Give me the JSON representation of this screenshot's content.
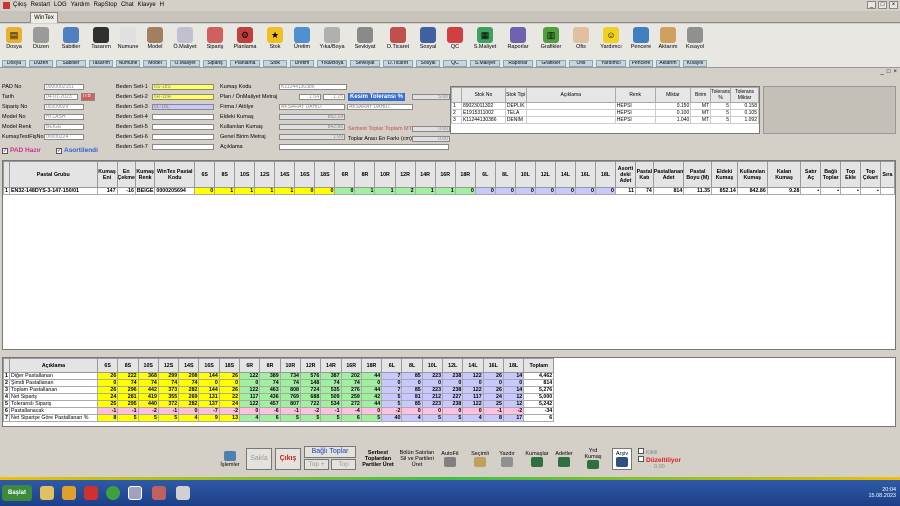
{
  "menu": [
    "Çıkış",
    "Restart",
    "LOG",
    "Yardım",
    "RapStop",
    "Chat",
    "Klavye",
    "H"
  ],
  "tab_title": "WinTex",
  "ribbon": [
    {
      "label": "Dosya",
      "sub": "Dosya",
      "icon": "folder-icon",
      "color": "#e8b030"
    },
    {
      "label": "Düzen",
      "sub": "Düzen",
      "icon": "edit-icon",
      "color": "#9a9a9a"
    },
    {
      "label": "Sabitler",
      "sub": "Sabitler",
      "icon": "pin-icon",
      "color": "#5080c0"
    },
    {
      "label": "Tasarım",
      "sub": "Tasarım",
      "icon": "design-icon",
      "color": "#303030"
    },
    {
      "label": "Numune",
      "sub": "Numune",
      "icon": "sample-icon",
      "color": "#e0e0e0"
    },
    {
      "label": "Model",
      "sub": "Model",
      "icon": "model-icon",
      "color": "#a08060"
    },
    {
      "label": "Ö.Maliyet",
      "sub": "Ö.Maliyet",
      "icon": "cost-icon",
      "color": "#c0c0d0"
    },
    {
      "label": "Sipariş",
      "sub": "Sipariş",
      "icon": "order-icon",
      "color": "#d06060"
    },
    {
      "label": "Planlama",
      "sub": "Planlama",
      "icon": "gear-icon",
      "color": "#c04040"
    },
    {
      "label": "Stok",
      "sub": "Stok",
      "icon": "star-icon",
      "color": "#f0c020"
    },
    {
      "label": "Üretim",
      "sub": "Üretim",
      "icon": "production-icon",
      "color": "#5090d0"
    },
    {
      "label": "Yıka/Boya",
      "sub": "Yıka/Boya",
      "icon": "dye-icon",
      "color": "#b0b0b0"
    },
    {
      "label": "Sevkiyat",
      "sub": "Sevkiyat",
      "icon": "shipping-icon",
      "color": "#8a8a8a"
    },
    {
      "label": "D.Ticaret",
      "sub": "D.Ticaret",
      "icon": "trade-icon",
      "color": "#c05050"
    },
    {
      "label": "Sosyal",
      "sub": "Sosyal",
      "icon": "social-icon",
      "color": "#4060a0"
    },
    {
      "label": "QC",
      "sub": "QC",
      "icon": "qc-icon",
      "color": "#d04040"
    },
    {
      "label": "S.Maliyet",
      "sub": "S.Maliyet",
      "icon": "calculator-icon",
      "color": "#40a060"
    },
    {
      "label": "Raporlar",
      "sub": "Raporlar",
      "icon": "report-icon",
      "color": "#7060b0"
    },
    {
      "label": "Grafikler",
      "sub": "Grafikler",
      "icon": "chart-icon",
      "color": "#50a040"
    },
    {
      "label": "Ofis",
      "sub": "Ofis",
      "icon": "office-icon",
      "color": "#e0c0a0"
    },
    {
      "label": "Yardımcı",
      "sub": "Yardımcı",
      "icon": "smiley-icon",
      "color": "#f0d020"
    },
    {
      "label": "Pencere",
      "sub": "Pencere",
      "icon": "window-icon",
      "color": "#4080c0"
    },
    {
      "label": "Aktarım",
      "sub": "Aktarım",
      "icon": "transfer-icon",
      "color": "#d0a060"
    },
    {
      "label": "Kısayol",
      "sub": "Kısayol",
      "icon": "shortcut-icon",
      "color": "#909090"
    }
  ],
  "form": {
    "pad_no": {
      "label": "PAD No",
      "value": "0000002151"
    },
    "tarih": {
      "label": "Tarih",
      "value": "04-01-2023",
      "btn": "ITB"
    },
    "siparis_no": {
      "label": "Sipariş No",
      "value": "00209029"
    },
    "model_no": {
      "label": "Model No",
      "value": "HI LASH"
    },
    "model_renk": {
      "label": "Model Renk",
      "value": "BEIGE"
    },
    "kumas_test": {
      "label": "KumaşTestFişNo",
      "value": "00000224"
    },
    "beden_setleri": [
      {
        "label": "Beden Seti-1",
        "value": "6S-18S",
        "color": "y"
      },
      {
        "label": "Beden Seti-2",
        "value": "6R-18R",
        "color": "y"
      },
      {
        "label": "Beden Seti-3",
        "value": "6L-18L",
        "color": "p"
      },
      {
        "label": "Beden Seti-4",
        "value": "",
        "color": ""
      },
      {
        "label": "Beden Seti-5",
        "value": "",
        "color": ""
      },
      {
        "label": "Beden Seti-6",
        "value": "",
        "color": ""
      },
      {
        "label": "Beden Seti-7",
        "value": "",
        "color": ""
      }
    ],
    "kumas_kodu": {
      "label": "Kumaş Kodu",
      "value": "K11244130386"
    },
    "plan_metraj": {
      "label": "Plan / ÖnMaliyet Metraj",
      "value1": "1.04",
      "value2": "1.15"
    },
    "firma": {
      "label": "Firma / Atölye",
      "value": "AKSARAY DAHİLİ",
      "value2": "AKSARAY DAHİLİ"
    },
    "eldeki_kumas": {
      "label": "Eldeki Kumaş",
      "value": "852.14"
    },
    "kullanilan_kumas": {
      "label": "Kullanılan Kumaş",
      "value": "842.86"
    },
    "genel_birim": {
      "label": "Genel Birim Metraj",
      "value": "1.09"
    },
    "aciklama": {
      "label": "Açıklama",
      "value": ""
    },
    "kesim_tol": {
      "label": "Kesim Toleransı %",
      "value": "5.00"
    },
    "serbest_toplam": {
      "label": "Serbest Toplar Toplam MT",
      "value": "0.00"
    },
    "toplar_arasi": {
      "label": "Toplar Arası En Farkı (cm)",
      "value": "0.00"
    }
  },
  "stock_table": {
    "headers": [
      "Stok No",
      "Stok Tipi",
      "Açıklama",
      "Renk",
      "Miktar",
      "Birim",
      "Tolerans %",
      "Tolerans Miktar"
    ],
    "rows": [
      [
        "1",
        "89023011302",
        "DEPLIK",
        "",
        "HEPSI",
        "0.150",
        "MT",
        "5",
        "0.158"
      ],
      [
        "2",
        "E1915311002",
        "TELA",
        "",
        "HEPSI",
        "0.100",
        "MT",
        "5",
        "0.105"
      ],
      [
        "3",
        "K11244130386",
        "DENIM",
        "",
        "HEPSI",
        "1.040",
        "MT",
        "5",
        "1.092"
      ]
    ]
  },
  "checks": {
    "pad_hazir": "PAD Hazır",
    "asortilendi": "Asortilendi"
  },
  "main_grid": {
    "headers": [
      "Pastal Grubu",
      "Kumaş Eni",
      "En Çekme",
      "Kumaş Renk",
      "WinTex Pastal Kodu",
      "6S",
      "8S",
      "10S",
      "12S",
      "14S",
      "16S",
      "18S",
      "6R",
      "8R",
      "10R",
      "12R",
      "14R",
      "16R",
      "18R",
      "6L",
      "8L",
      "10L",
      "12L",
      "14L",
      "16L",
      "18L",
      "Asorti deki Adet",
      "Pastal Katı",
      "Pastallanan Adet",
      "Pastal Boyu (M)",
      "Eldeki Kumaş",
      "Kullanılan Kumaş",
      "Kalan Kumaş",
      "Satır Aç",
      "Bağlı Toplar",
      "Top Ekle",
      "Top Çıkart",
      "Sıra"
    ],
    "rows": [
      [
        "1",
        "EN32-148DYS-3-147-150/01",
        "147",
        "-16",
        "BEIGE",
        "0000205694",
        "0",
        "1",
        "1",
        "1",
        "1",
        "0",
        "0",
        "0",
        "1",
        "1",
        "2",
        "1",
        "1",
        "0",
        "0",
        "0",
        "0",
        "0",
        "0",
        "0",
        "0",
        "11",
        "74",
        "814",
        "11.35",
        "852.14",
        "842.86",
        "9.28",
        "▪",
        "▪",
        "▪",
        "▪",
        ""
      ]
    ]
  },
  "bottom_grid": {
    "headers": [
      "Açıklama",
      "6S",
      "8S",
      "10S",
      "12S",
      "14S",
      "16S",
      "18S",
      "6R",
      "8R",
      "10R",
      "12R",
      "14R",
      "16R",
      "18R",
      "6L",
      "8L",
      "10L",
      "12L",
      "14L",
      "16L",
      "18L",
      "Toplam"
    ],
    "rows": [
      [
        "1",
        "Diğer Pastallanan",
        "26",
        "222",
        "368",
        "299",
        "208",
        "144",
        "26",
        "122",
        "389",
        "734",
        "576",
        "387",
        "202",
        "44",
        "7",
        "85",
        "223",
        "238",
        "122",
        "26",
        "14",
        "4,462"
      ],
      [
        "2",
        "Şimdi Pastallanan",
        "0",
        "74",
        "74",
        "74",
        "74",
        "0",
        "0",
        "0",
        "74",
        "74",
        "148",
        "74",
        "74",
        "0",
        "0",
        "0",
        "0",
        "0",
        "0",
        "0",
        "0",
        "814"
      ],
      [
        "3",
        "Toplam Pastallanan",
        "26",
        "296",
        "442",
        "373",
        "282",
        "144",
        "26",
        "122",
        "463",
        "808",
        "724",
        "535",
        "276",
        "44",
        "7",
        "85",
        "223",
        "238",
        "122",
        "26",
        "14",
        "5,276"
      ],
      [
        "4",
        "Net Sipariş",
        "24",
        "281",
        "419",
        "355",
        "269",
        "131",
        "22",
        "117",
        "436",
        "769",
        "688",
        "509",
        "259",
        "42",
        "5",
        "81",
        "212",
        "227",
        "117",
        "24",
        "12",
        "5,000"
      ],
      [
        "5",
        "Toleranslı Sipariş",
        "25",
        "295",
        "440",
        "372",
        "282",
        "137",
        "24",
        "122",
        "457",
        "807",
        "722",
        "534",
        "272",
        "44",
        "5",
        "85",
        "223",
        "238",
        "122",
        "25",
        "12",
        "5,242"
      ],
      [
        "6",
        "Pastallanacak",
        "-1",
        "-1",
        "-2",
        "-1",
        "0",
        "-7",
        "-2",
        "0",
        "-6",
        "-1",
        "-2",
        "-1",
        "-4",
        "0",
        "-2",
        "0",
        "0",
        "0",
        "0",
        "-1",
        "-2",
        "-34"
      ],
      [
        "7",
        "Net Siparişe Göre Pastallanan %",
        "8",
        "5",
        "5",
        "5",
        "4",
        "9",
        "13",
        "4",
        "6",
        "5",
        "5",
        "5",
        "6",
        "5",
        "40",
        "4",
        "5",
        "5",
        "4",
        "8",
        "17",
        "6"
      ]
    ]
  },
  "bottom_buttons": {
    "islemler": "İşlemler",
    "sakla": "Sakla",
    "cikis": "Çıkış",
    "bagli_toplar": "Bağlı Toplar",
    "top_ekle": "Top +",
    "top": "Top",
    "serbest": "Serbest Toplardan Partiler Üret",
    "bolun": "Bölün Satırları Sil ve Partileri Üret",
    "autofit": "AutoFit",
    "secimli": "Seçimli",
    "yazdir": "Yazdır",
    "kumaslar": "Kumaşlar",
    "adetler": "Adetler",
    "yrd_kumas": "Yrd Kumaş",
    "arsiv": "Arşiv",
    "kilitli": "Kilitli",
    "duzeltiliyor": "Düzeltiliyor",
    "ratio": "0.00"
  },
  "taskbar": {
    "start": "Başlat",
    "time": "20:04",
    "date": "15.08.2023"
  }
}
